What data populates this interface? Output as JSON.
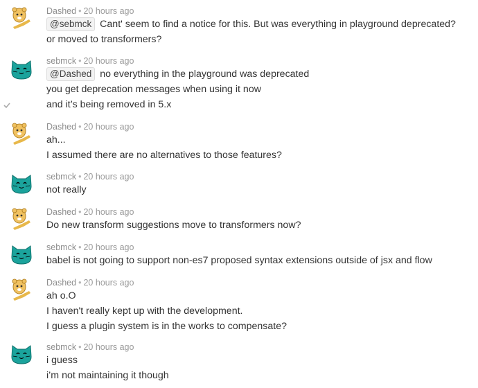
{
  "messages": [
    {
      "author": "Dashed",
      "time": "20 hours ago",
      "avatar": "hamster-icon",
      "lines": [
        {
          "mention": "@sebmck",
          "text": "Cant' seem to find a notice for this. But was everything in playground deprecated?"
        },
        {
          "text": "or moved to transformers?"
        }
      ]
    },
    {
      "author": "sebmck",
      "time": "20 hours ago",
      "avatar": "cat-icon",
      "lines": [
        {
          "mention": "@Dashed",
          "text": "no everything in the playground was deprecated"
        },
        {
          "text": "you get deprecation messages when using it now"
        },
        {
          "text": "and it’s being removed in 5.x"
        }
      ]
    },
    {
      "author": "Dashed",
      "time": "20 hours ago",
      "avatar": "hamster-icon",
      "lines": [
        {
          "text": "ah..."
        },
        {
          "text": "I assumed there are no alternatives to those features?"
        }
      ]
    },
    {
      "author": "sebmck",
      "time": "20 hours ago",
      "avatar": "cat-icon",
      "lines": [
        {
          "text": "not really"
        }
      ]
    },
    {
      "author": "Dashed",
      "time": "20 hours ago",
      "avatar": "hamster-icon",
      "lines": [
        {
          "text": "Do new transform suggestions move to transformers now?"
        }
      ]
    },
    {
      "author": "sebmck",
      "time": "20 hours ago",
      "avatar": "cat-icon",
      "lines": [
        {
          "text": "babel is not going to support non-es7 proposed syntax extensions outside of jsx and flow"
        }
      ]
    },
    {
      "author": "Dashed",
      "time": "20 hours ago",
      "avatar": "hamster-icon",
      "lines": [
        {
          "text": "ah o.O"
        },
        {
          "text": "I haven't really kept up with the development."
        },
        {
          "text": "I guess a plugin system is in the works to compensate?"
        }
      ]
    },
    {
      "author": "sebmck",
      "time": "20 hours ago",
      "avatar": "cat-icon",
      "lines": [
        {
          "text": "i guess"
        },
        {
          "text": "i’m not maintaining it though"
        }
      ]
    }
  ],
  "separator": "•",
  "colors": {
    "cat": "#1ba39c",
    "hamster": "#e8b84a",
    "meta": "#9a9a9a"
  }
}
